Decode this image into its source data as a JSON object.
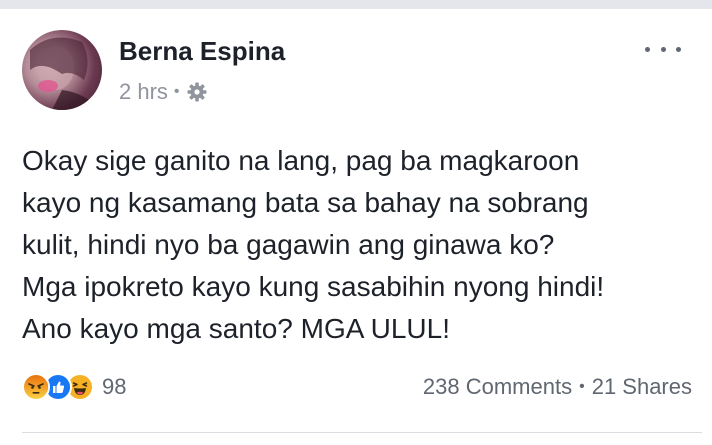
{
  "post": {
    "author": "Berna Espina",
    "time": "2 hrs",
    "privacy_icon": "gear-icon",
    "menu_icon": "more-horizontal-icon",
    "body_lines": [
      "Okay sige ganito na lang, pag ba magkaroon",
      "kayo ng kasamang bata sa bahay na sobrang",
      "kulit, hindi nyo ba gagawin ang ginawa ko?",
      "Mga ipokreto kayo kung sasabihin nyong hindi!",
      "Ano kayo mga santo? MGA ULUL!"
    ]
  },
  "footer": {
    "reactions": [
      {
        "type": "angry",
        "icon": "angry-reaction-icon",
        "color": "#f5a623"
      },
      {
        "type": "like",
        "icon": "like-reaction-icon",
        "color": "#1877f2"
      },
      {
        "type": "haha",
        "icon": "haha-reaction-icon",
        "color": "#f7b125"
      }
    ],
    "reaction_count": "98",
    "comments": "238 Comments",
    "shares": "21 Shares"
  },
  "colors": {
    "text": "#1d2129",
    "secondary": "#90949c",
    "like_blue": "#1877f2"
  }
}
